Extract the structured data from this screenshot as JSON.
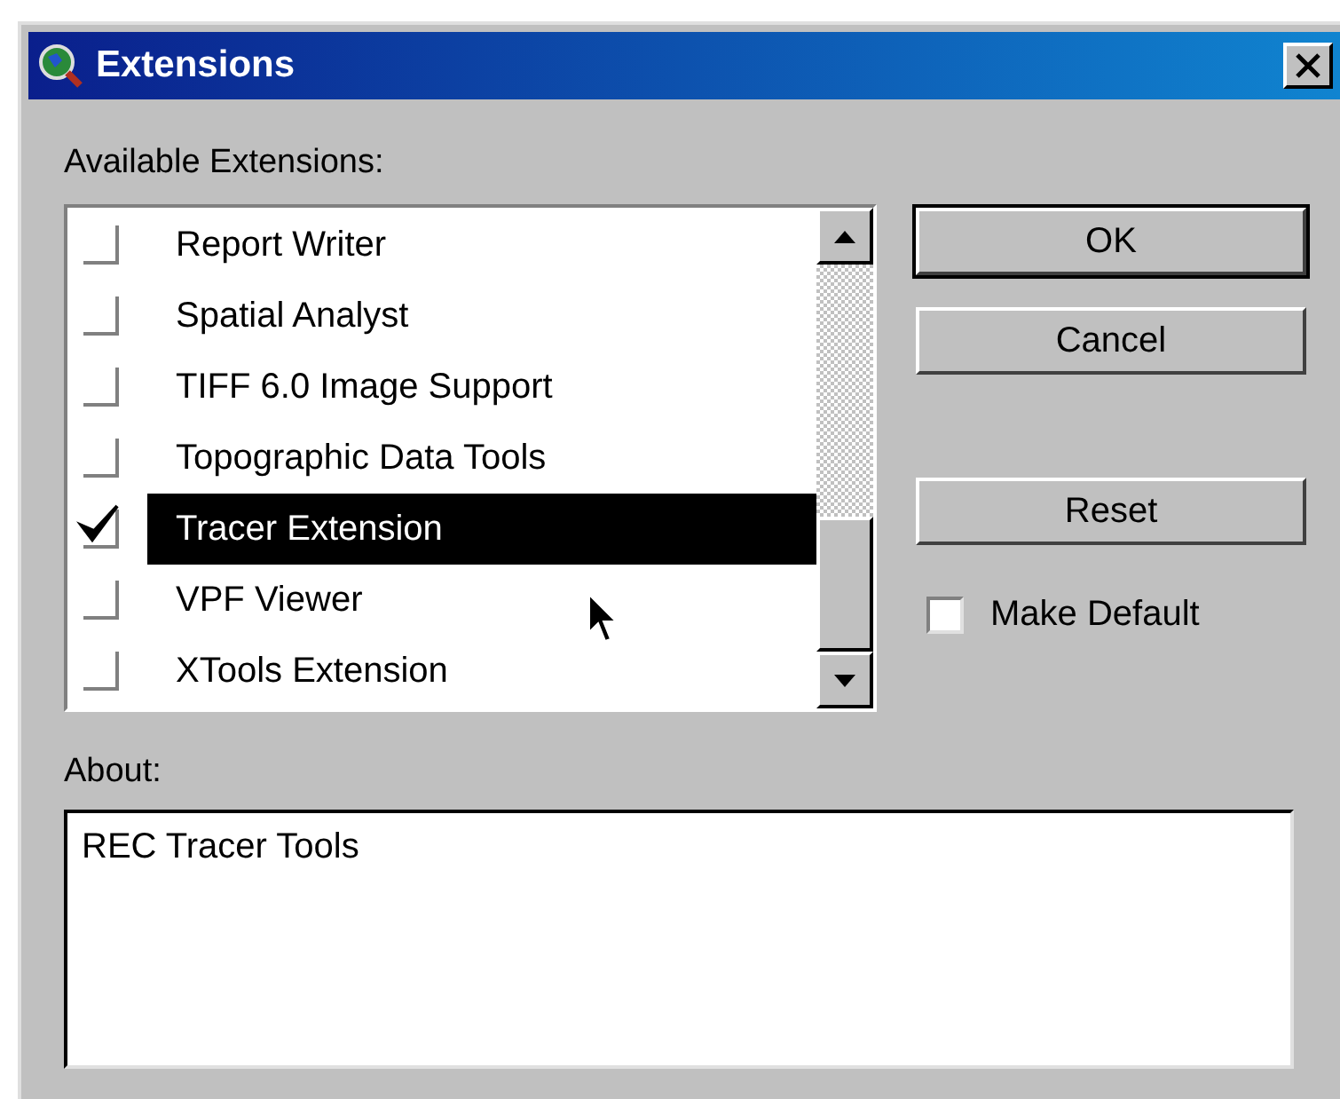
{
  "window": {
    "title": "Extensions"
  },
  "extensions_label": "Available Extensions:",
  "extensions": [
    {
      "label": "Report Writer",
      "checked": false,
      "selected": false
    },
    {
      "label": "Spatial Analyst",
      "checked": false,
      "selected": false
    },
    {
      "label": "TIFF 6.0 Image Support",
      "checked": false,
      "selected": false
    },
    {
      "label": "Topographic Data Tools",
      "checked": false,
      "selected": false
    },
    {
      "label": "Tracer Extension",
      "checked": true,
      "selected": true
    },
    {
      "label": "VPF Viewer",
      "checked": false,
      "selected": false
    },
    {
      "label": "XTools Extension",
      "checked": false,
      "selected": false
    }
  ],
  "buttons": [
    {
      "label": "OK",
      "default": true
    },
    {
      "label": "Cancel",
      "default": false
    },
    {
      "label": "Reset",
      "default": false
    }
  ],
  "make_default": {
    "label": "Make Default",
    "checked": false
  },
  "about_label": "About:",
  "about_text": "REC Tracer Tools"
}
